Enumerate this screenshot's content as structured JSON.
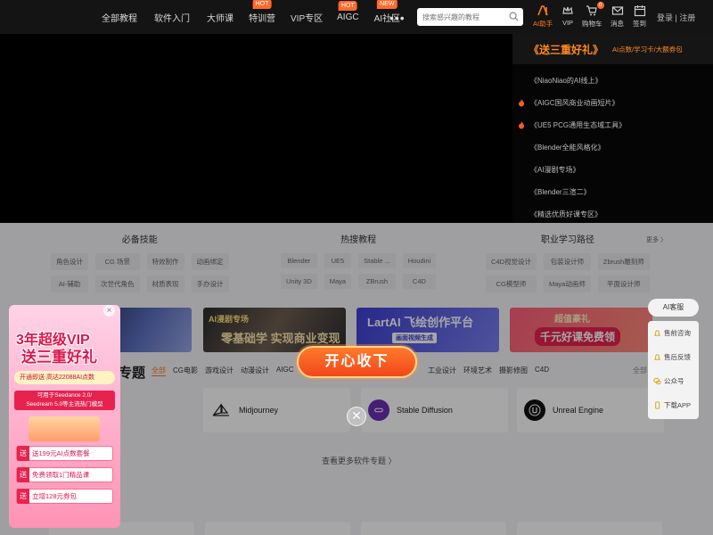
{
  "nav": {
    "links": [
      {
        "label": "全部教程"
      },
      {
        "label": "软件入门"
      },
      {
        "label": "大师课"
      },
      {
        "label": "特训营",
        "badge": "HOT"
      },
      {
        "label": "VIP专区"
      },
      {
        "label": "AIGC",
        "badge": "HOT"
      },
      {
        "label": "AI社区",
        "badge": "NEW"
      }
    ],
    "more": "•••",
    "search_placeholder": "搜索感兴趣的教程",
    "icons": [
      {
        "label": "AI助手",
        "icon": "ai-icon"
      },
      {
        "label": "VIP",
        "icon": "vip-crown-icon"
      },
      {
        "label": "购物车",
        "icon": "cart-icon",
        "count": "0"
      },
      {
        "label": "消息",
        "icon": "mail-icon"
      },
      {
        "label": "签到",
        "icon": "calendar-icon"
      }
    ],
    "login": "登录 | 注册"
  },
  "dropdown": {
    "title": "《送三重好礼》",
    "subtitle": "AI点数/学习卡/大额券包",
    "items": [
      {
        "label": "《NiaoNiao的AI线上》",
        "hot": false
      },
      {
        "label": "《AIGC国风商业动画短片》",
        "hot": true
      },
      {
        "label": "《UE5 PCG通用生态域工具》",
        "hot": true
      },
      {
        "label": "《Blender全能风格化》",
        "hot": false
      },
      {
        "label": "《AI漫剧专场》",
        "hot": false
      },
      {
        "label": "《Blender三渲二》",
        "hot": false
      },
      {
        "label": "《精选优质好课专区》",
        "hot": false
      }
    ]
  },
  "categories": {
    "skills": {
      "title": "必备技能",
      "tags": [
        "角色设计",
        "CG 场景",
        "特效制作",
        "动画绑定",
        "AI-辅助",
        "次世代角色",
        "材质表现",
        "手办设计"
      ]
    },
    "hot": {
      "title": "热搜教程",
      "tags": [
        "Blender",
        "UE5",
        "Stable ...",
        "Houdini",
        "Unity 3D",
        "Maya",
        "ZBrush",
        "C4D"
      ]
    },
    "career": {
      "title": "职业学习路径",
      "more": "更多 〉",
      "tags": [
        "C4D视觉设计",
        "包装设计师",
        "Zbrush雕刻师",
        "CG模型师",
        "Maya动画师",
        "平面设计师"
      ]
    }
  },
  "banners": [
    {
      "text": ""
    },
    {
      "text": "零基础学 实现商业变现",
      "tag": "AI漫剧专场"
    },
    {
      "text": "LartAI 飞绘创作平台",
      "sub": "画面视频生成"
    },
    {
      "text": "千元好课免费领",
      "tag": "超值豪礼"
    }
  ],
  "software_section": {
    "title": "专题",
    "tabs": [
      "全部",
      "CG电影",
      "游戏设计",
      "动漫设计",
      "AIGC"
    ],
    "tabs_right": [
      "工业设计",
      "环境艺术",
      "摄影修图",
      "C4D"
    ],
    "more": "全部 〉",
    "cards": [
      {
        "name": "Midjourney"
      },
      {
        "name": "Stable Diffusion"
      },
      {
        "name": "Unreal Engine"
      }
    ],
    "view_more": "查看更多软件专题 〉"
  },
  "side_panel": {
    "ai_service": "AI客服",
    "items": [
      {
        "label": "售前咨询",
        "icon": "bell-icon"
      },
      {
        "label": "售后反馈",
        "icon": "bell-icon"
      },
      {
        "label": "公众号",
        "icon": "wechat-icon"
      },
      {
        "label": "下载APP",
        "icon": "phone-icon"
      }
    ]
  },
  "promo": {
    "line1": "3年超级VIP",
    "line2": "送三重好礼",
    "strip": "开通即送 高达22088AI点数",
    "desc1": "可用于Seedance 2.0/",
    "desc2": "Seedream 5.0等主流热门模型",
    "items": [
      {
        "tag": "送",
        "label": "送199元AI点数套餐"
      },
      {
        "tag": "送",
        "label": "免费领取1门精品课"
      },
      {
        "tag": "送",
        "label": "立增128元券包"
      }
    ],
    "close": "×"
  },
  "modal": {
    "button": "开心收下",
    "close": "✕"
  },
  "colors": {
    "accent": "#ff7a1a",
    "brand_red": "#e0154e"
  }
}
